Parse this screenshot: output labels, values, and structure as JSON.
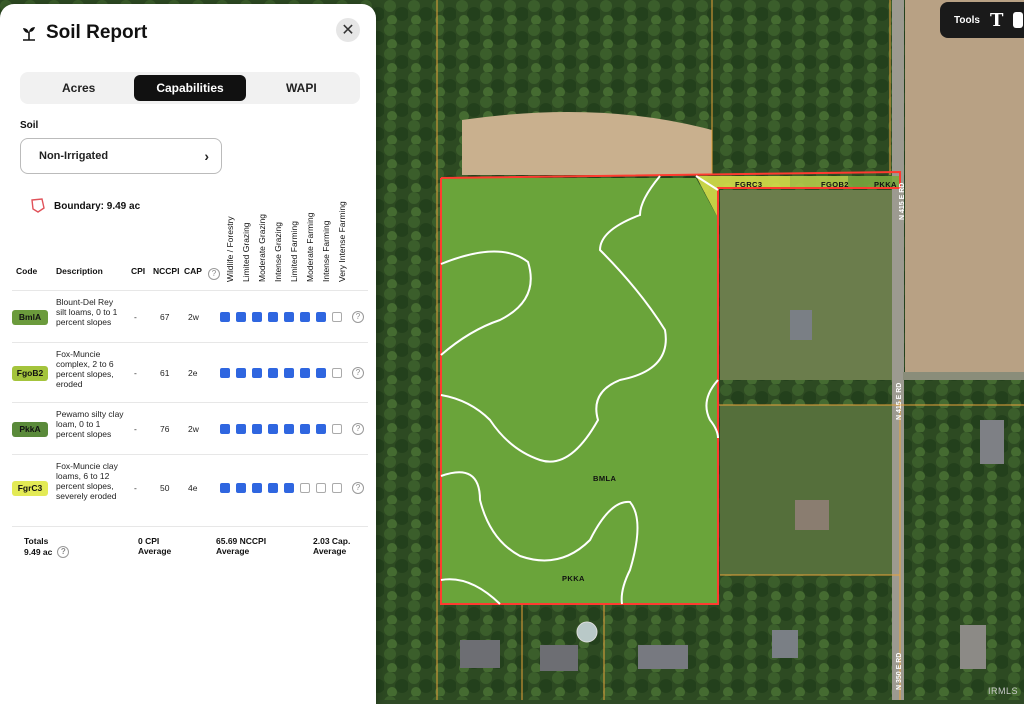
{
  "panel": {
    "title": "Soil Report",
    "close_icon": "close-icon",
    "tabs": [
      {
        "label": "Acres",
        "active": false
      },
      {
        "label": "Capabilities",
        "active": true
      },
      {
        "label": "WAPI",
        "active": false
      }
    ],
    "soil_label": "Soil",
    "soil_select": "Non-Irrigated",
    "boundary": "Boundary: 9.49 ac",
    "columns": {
      "code": "Code",
      "description": "Description",
      "cpi": "CPI",
      "nccpi": "NCCPI",
      "cap": "CAP"
    },
    "capability_headers": [
      "Wildlife / Forestry",
      "Limited Grazing",
      "Moderate Grazing",
      "Intense Grazing",
      "Limited Farming",
      "Moderate Farming",
      "Intense Farming",
      "Very Intense Farming"
    ],
    "rows": [
      {
        "code": "BmlA",
        "description": "Blount-Del Rey silt loams, 0 to 1 percent slopes",
        "cpi": "-",
        "nccpi": "67",
        "cap": "2w",
        "level": 7,
        "color": "#6b9b3c"
      },
      {
        "code": "FgoB2",
        "description": "Fox-Muncie complex, 2 to 6 percent slopes, eroded",
        "cpi": "-",
        "nccpi": "61",
        "cap": "2e",
        "level": 7,
        "color": "#a4c43c"
      },
      {
        "code": "PkkA",
        "description": "Pewamo silty clay loam, 0 to 1 percent slopes",
        "cpi": "-",
        "nccpi": "76",
        "cap": "2w",
        "level": 7,
        "color": "#5a8a3a"
      },
      {
        "code": "FgrC3",
        "description": "Fox-Muncie clay loams, 6 to 12 percent slopes, severely eroded",
        "cpi": "-",
        "nccpi": "50",
        "cap": "4e",
        "level": 5,
        "color": "#e3ea55"
      }
    ],
    "totals": {
      "label": "Totals",
      "acres": "9.49 ac",
      "cpi": "0 CPI",
      "cpi_sub": "Average",
      "nccpi": "65.69 NCCPI",
      "nccpi_sub": "Average",
      "cap": "2.03 Cap.",
      "cap_sub": "Average"
    }
  },
  "tools": {
    "label": "Tools",
    "text_icon": "text-tool-icon"
  },
  "map": {
    "labels": [
      "BMLA",
      "PKKA",
      "FGRC3",
      "FGOB2",
      "PKKA"
    ],
    "roads": [
      "N 415 E RD",
      "N 415 E RD",
      "N 350 E RD"
    ],
    "watermark": "IRMLS",
    "colors": {
      "boundary": "#ff3b30",
      "soil_line": "#ffffff",
      "field": "#6aa43a"
    }
  }
}
